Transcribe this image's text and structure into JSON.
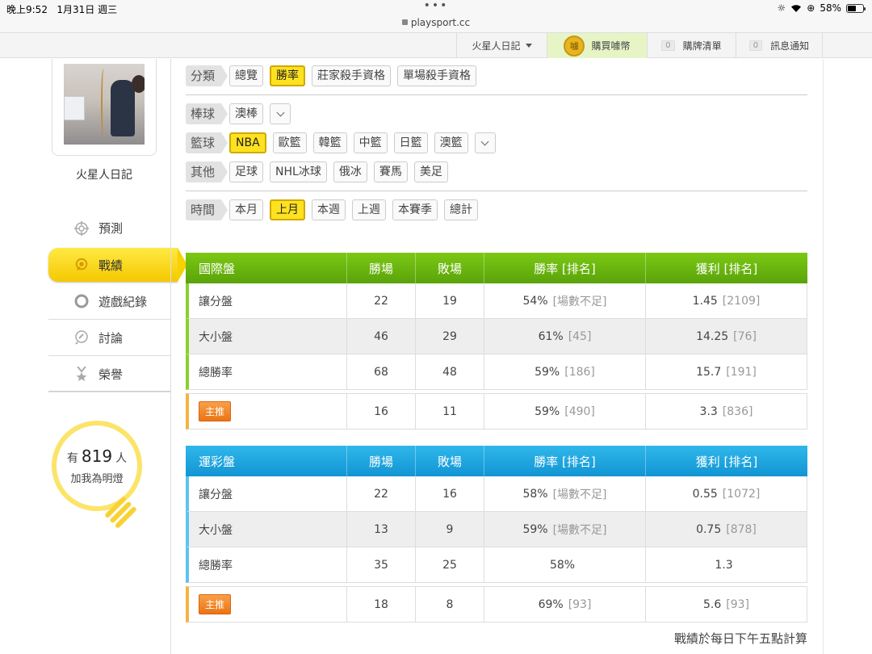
{
  "status_bar": {
    "time": "晚上9:52",
    "date": "1月31日 週三",
    "url": "playsport.cc",
    "battery": "58%",
    "battery_level": 0.58
  },
  "top_nav": {
    "user": "火星人日記",
    "buy_coin": "購買噱幣",
    "coin_icon_text": "噱",
    "cart": "購牌清單",
    "cart_count": "0",
    "notify": "訊息通知",
    "notify_count": "0"
  },
  "profile": {
    "nickname": "火星人日記"
  },
  "side_menu": [
    {
      "label": "預測",
      "icon": "target-icon"
    },
    {
      "label": "戰績",
      "icon": "record-icon",
      "active": true
    },
    {
      "label": "遊戲紀錄",
      "icon": "circle-icon"
    },
    {
      "label": "討論",
      "icon": "discussion-icon"
    },
    {
      "label": "榮譽",
      "icon": "medal-icon"
    }
  ],
  "fans": {
    "prefix": "有",
    "count": "819",
    "suffix": "人",
    "caption": "加我為明燈"
  },
  "filters": {
    "category": {
      "label": "分類",
      "options": [
        "總覽",
        "勝率",
        "莊家殺手資格",
        "單場殺手資格"
      ],
      "selected": "勝率"
    },
    "baseball": {
      "label": "棒球",
      "options": [
        "澳棒"
      ]
    },
    "basketball": {
      "label": "籃球",
      "options": [
        "NBA",
        "歐籃",
        "韓籃",
        "中籃",
        "日籃",
        "澳籃"
      ],
      "selected": "NBA"
    },
    "other": {
      "label": "其他",
      "options": [
        "足球",
        "NHL冰球",
        "俄冰",
        "賽馬",
        "美足"
      ]
    },
    "time": {
      "label": "時間",
      "options": [
        "本月",
        "上月",
        "本週",
        "上週",
        "本賽季",
        "總計"
      ],
      "selected": "上月"
    }
  },
  "table_international": {
    "headers": [
      "國際盤",
      "勝場",
      "敗場",
      "勝率 [排名]",
      "獲利 [排名]"
    ],
    "rows": [
      {
        "name": "讓分盤",
        "win": "22",
        "loss": "19",
        "rate": "54%",
        "rate_rank": "[場數不足]",
        "profit": "1.45",
        "profit_rank": "[2109]"
      },
      {
        "name": "大小盤",
        "win": "46",
        "loss": "29",
        "rate": "61%",
        "rate_rank": "[45]",
        "profit": "14.25",
        "profit_rank": "[76]"
      },
      {
        "name": "總勝率",
        "win": "68",
        "loss": "48",
        "rate": "59%",
        "rate_rank": "[186]",
        "profit": "15.7",
        "profit_rank": "[191]"
      }
    ],
    "main": {
      "badge": "主推",
      "win": "16",
      "loss": "11",
      "rate": "59%",
      "rate_rank": "[490]",
      "profit": "3.3",
      "profit_rank": "[836]"
    }
  },
  "table_lottery": {
    "headers": [
      "運彩盤",
      "勝場",
      "敗場",
      "勝率 [排名]",
      "獲利 [排名]"
    ],
    "rows": [
      {
        "name": "讓分盤",
        "win": "22",
        "loss": "16",
        "rate": "58%",
        "rate_rank": "[場數不足]",
        "profit": "0.55",
        "profit_rank": "[1072]"
      },
      {
        "name": "大小盤",
        "win": "13",
        "loss": "9",
        "rate": "59%",
        "rate_rank": "[場數不足]",
        "profit": "0.75",
        "profit_rank": "[878]"
      },
      {
        "name": "總勝率",
        "win": "35",
        "loss": "25",
        "rate": "58%",
        "rate_rank": "",
        "profit": "1.3",
        "profit_rank": ""
      }
    ],
    "main": {
      "badge": "主推",
      "win": "18",
      "loss": "8",
      "rate": "69%",
      "rate_rank": "[93]",
      "profit": "5.6",
      "profit_rank": "[93]"
    }
  },
  "footnote": "戰績於每日下午五點計算"
}
